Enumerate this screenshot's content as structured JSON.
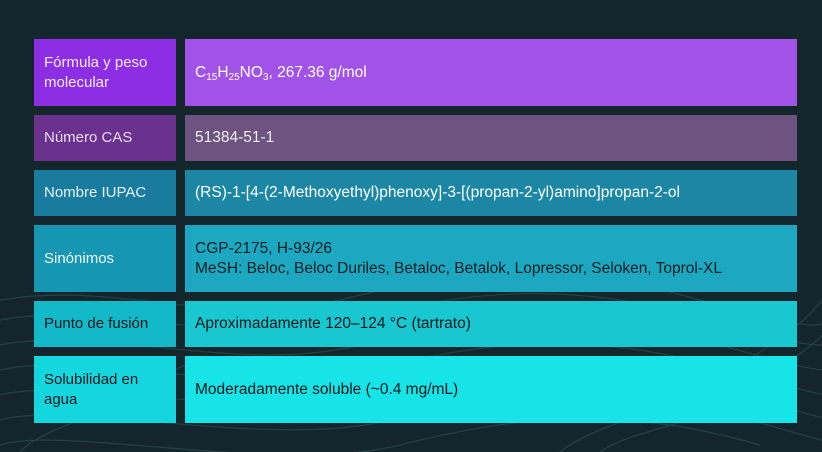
{
  "colors": {
    "background": "#12262c",
    "rows": [
      {
        "label_bg": "#8c2ee3",
        "value_bg": "#a153e8",
        "label_fg": "#f4ecfc",
        "value_fg": "#ffffff"
      },
      {
        "label_bg": "#6a318e",
        "value_bg": "#6d537f",
        "label_fg": "#e8dcef",
        "value_fg": "#f2f2f2"
      },
      {
        "label_bg": "#197c9e",
        "value_bg": "#1c86a5",
        "label_fg": "#e5f3f8",
        "value_fg": "#ffffff"
      },
      {
        "label_bg": "#1796b3",
        "value_bg": "#1ca8c0",
        "label_fg": "#f0fafc",
        "value_fg": "#0c1e24"
      },
      {
        "label_bg": "#12b9c9",
        "value_bg": "#19c7d1",
        "label_fg": "#08181c",
        "value_fg": "#08181c"
      },
      {
        "label_bg": "#14d6de",
        "value_bg": "#17e4e6",
        "label_fg": "#08181c",
        "value_fg": "#08181c"
      }
    ]
  },
  "rows": [
    {
      "label": "Fórmula y peso molecular",
      "formula": {
        "c": "C",
        "c_sub": "15",
        "h": "H",
        "h_sub": "25",
        "no": "NO",
        "no_sub": "3"
      },
      "value_suffix": ", 267.36 g/mol"
    },
    {
      "label": "Número CAS",
      "value": "51384-51-1"
    },
    {
      "label": "Nombre IUPAC",
      "value": "(RS)-1-[4-(2-Methoxyethyl)phenoxy]-3-[(propan-2-yl)amino]propan-2-ol"
    },
    {
      "label": "Sinónimos",
      "value_line1": "CGP-2175, H-93/26",
      "value_line2": "MeSH: Beloc, Beloc Duriles, Betaloc, Betalok, Lopressor, Seloken, Toprol-XL"
    },
    {
      "label": "Punto de fusión",
      "value": "Aproximadamente 120–124 °C (tartrato)"
    },
    {
      "label": "Solubilidad en agua",
      "value": "Moderadamente soluble (~0.4 mg/mL)"
    }
  ]
}
